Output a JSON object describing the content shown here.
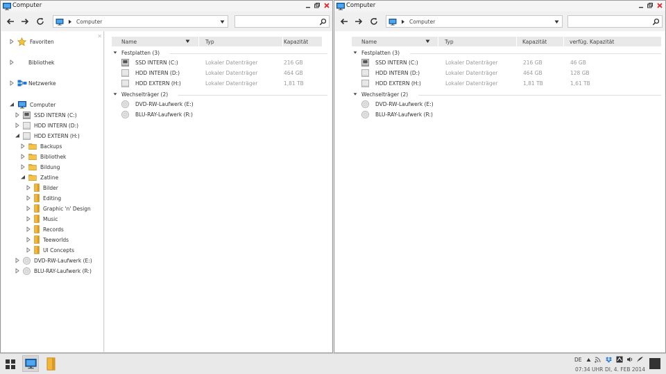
{
  "window_title": "Computer",
  "breadcrumb": "Computer",
  "search": {
    "placeholder": ""
  },
  "columns_left": [
    "Name",
    "Typ",
    "Kapazität"
  ],
  "columns_right": [
    "Name",
    "Typ",
    "Kapazität",
    "verfüg. Kapazität"
  ],
  "groups": {
    "fixed": "Festplatten (3)",
    "removable": "Wechselträger (2)"
  },
  "drives": [
    {
      "name": "SSD INTERN (C:)",
      "type": "Lokaler Datenträger",
      "capacity": "216 GB",
      "free": "46 GB",
      "icon": "ssd-drive-icon"
    },
    {
      "name": "HDD INTERN (D:)",
      "type": "Lokaler Datenträger",
      "capacity": "464 GB",
      "free": "128 GB",
      "icon": "hdd-drive-icon"
    },
    {
      "name": "HDD EXTERN (H:)",
      "type": "Lokaler Datenträger",
      "capacity": "1,81 TB",
      "free": "1,61 TB",
      "icon": "hdd-drive-icon"
    }
  ],
  "removables": [
    {
      "name": "DVD-RW-Laufwerk (E:)",
      "icon": "optical-disc-icon"
    },
    {
      "name": "BLU-RAY-Laufwerk (R:)",
      "icon": "optical-disc-icon"
    }
  ],
  "sidebar": {
    "favorites": "Favoriten",
    "library": "Bibliothek",
    "network": "Netzwerke",
    "computer": "Computer",
    "drives": [
      "SSD INTERN (C:)",
      "HDD INTERN (D:)",
      "HDD EXTERN (H:)"
    ],
    "ext_folders": [
      "Backups",
      "Bibliothek",
      "Bildung",
      "Zatline"
    ],
    "zatline_folders": [
      "Bilder",
      "Editing",
      "Graphic 'n' Design",
      "Music",
      "Records",
      "Teeworlds",
      "UI Concepts"
    ],
    "removables": [
      "DVD-RW-Laufwerk (E:)",
      "BLU-RAY-Laufwerk (R:)"
    ]
  },
  "tray": {
    "language": "DE",
    "time": "07:34 UHR",
    "date": "DI, 4. FEB 2014"
  },
  "colors": {
    "close": "#d9262c",
    "folder": "#f0b73c",
    "monitor": "#1f7ad0",
    "star": "#f3c33a"
  }
}
